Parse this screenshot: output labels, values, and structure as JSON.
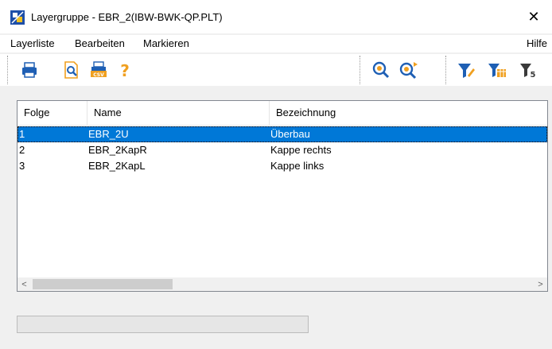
{
  "window": {
    "title": "Layergruppe - EBR_2(IBW-BWK-QP.PLT)",
    "close_symbol": "✕"
  },
  "menu": {
    "items": [
      "Layerliste",
      "Bearbeiten",
      "Markieren"
    ],
    "help": "Hilfe"
  },
  "toolbar": {
    "buttons": [
      "printer-icon",
      "print-preview-icon",
      "csv-export-icon",
      "help-icon",
      "zoom-icon",
      "zoom-next-icon",
      "filter-edit-icon",
      "filter-table-icon",
      "filter-reset-icon"
    ]
  },
  "list": {
    "columns": [
      "Folge",
      "Name",
      "Bezeichnung"
    ],
    "rows": [
      {
        "folge": "1",
        "name": "EBR_2U",
        "bezeichnung": "Überbau",
        "selected": true
      },
      {
        "folge": "2",
        "name": "EBR_2KapR",
        "bezeichnung": "Kappe rechts",
        "selected": false
      },
      {
        "folge": "3",
        "name": "EBR_2KapL",
        "bezeichnung": "Kappe links",
        "selected": false
      }
    ],
    "scroll_left": "<",
    "scroll_right": ">"
  },
  "colors": {
    "selection": "#0078d7",
    "accent_blue": "#1e5fb4",
    "accent_orange": "#f0a020"
  }
}
